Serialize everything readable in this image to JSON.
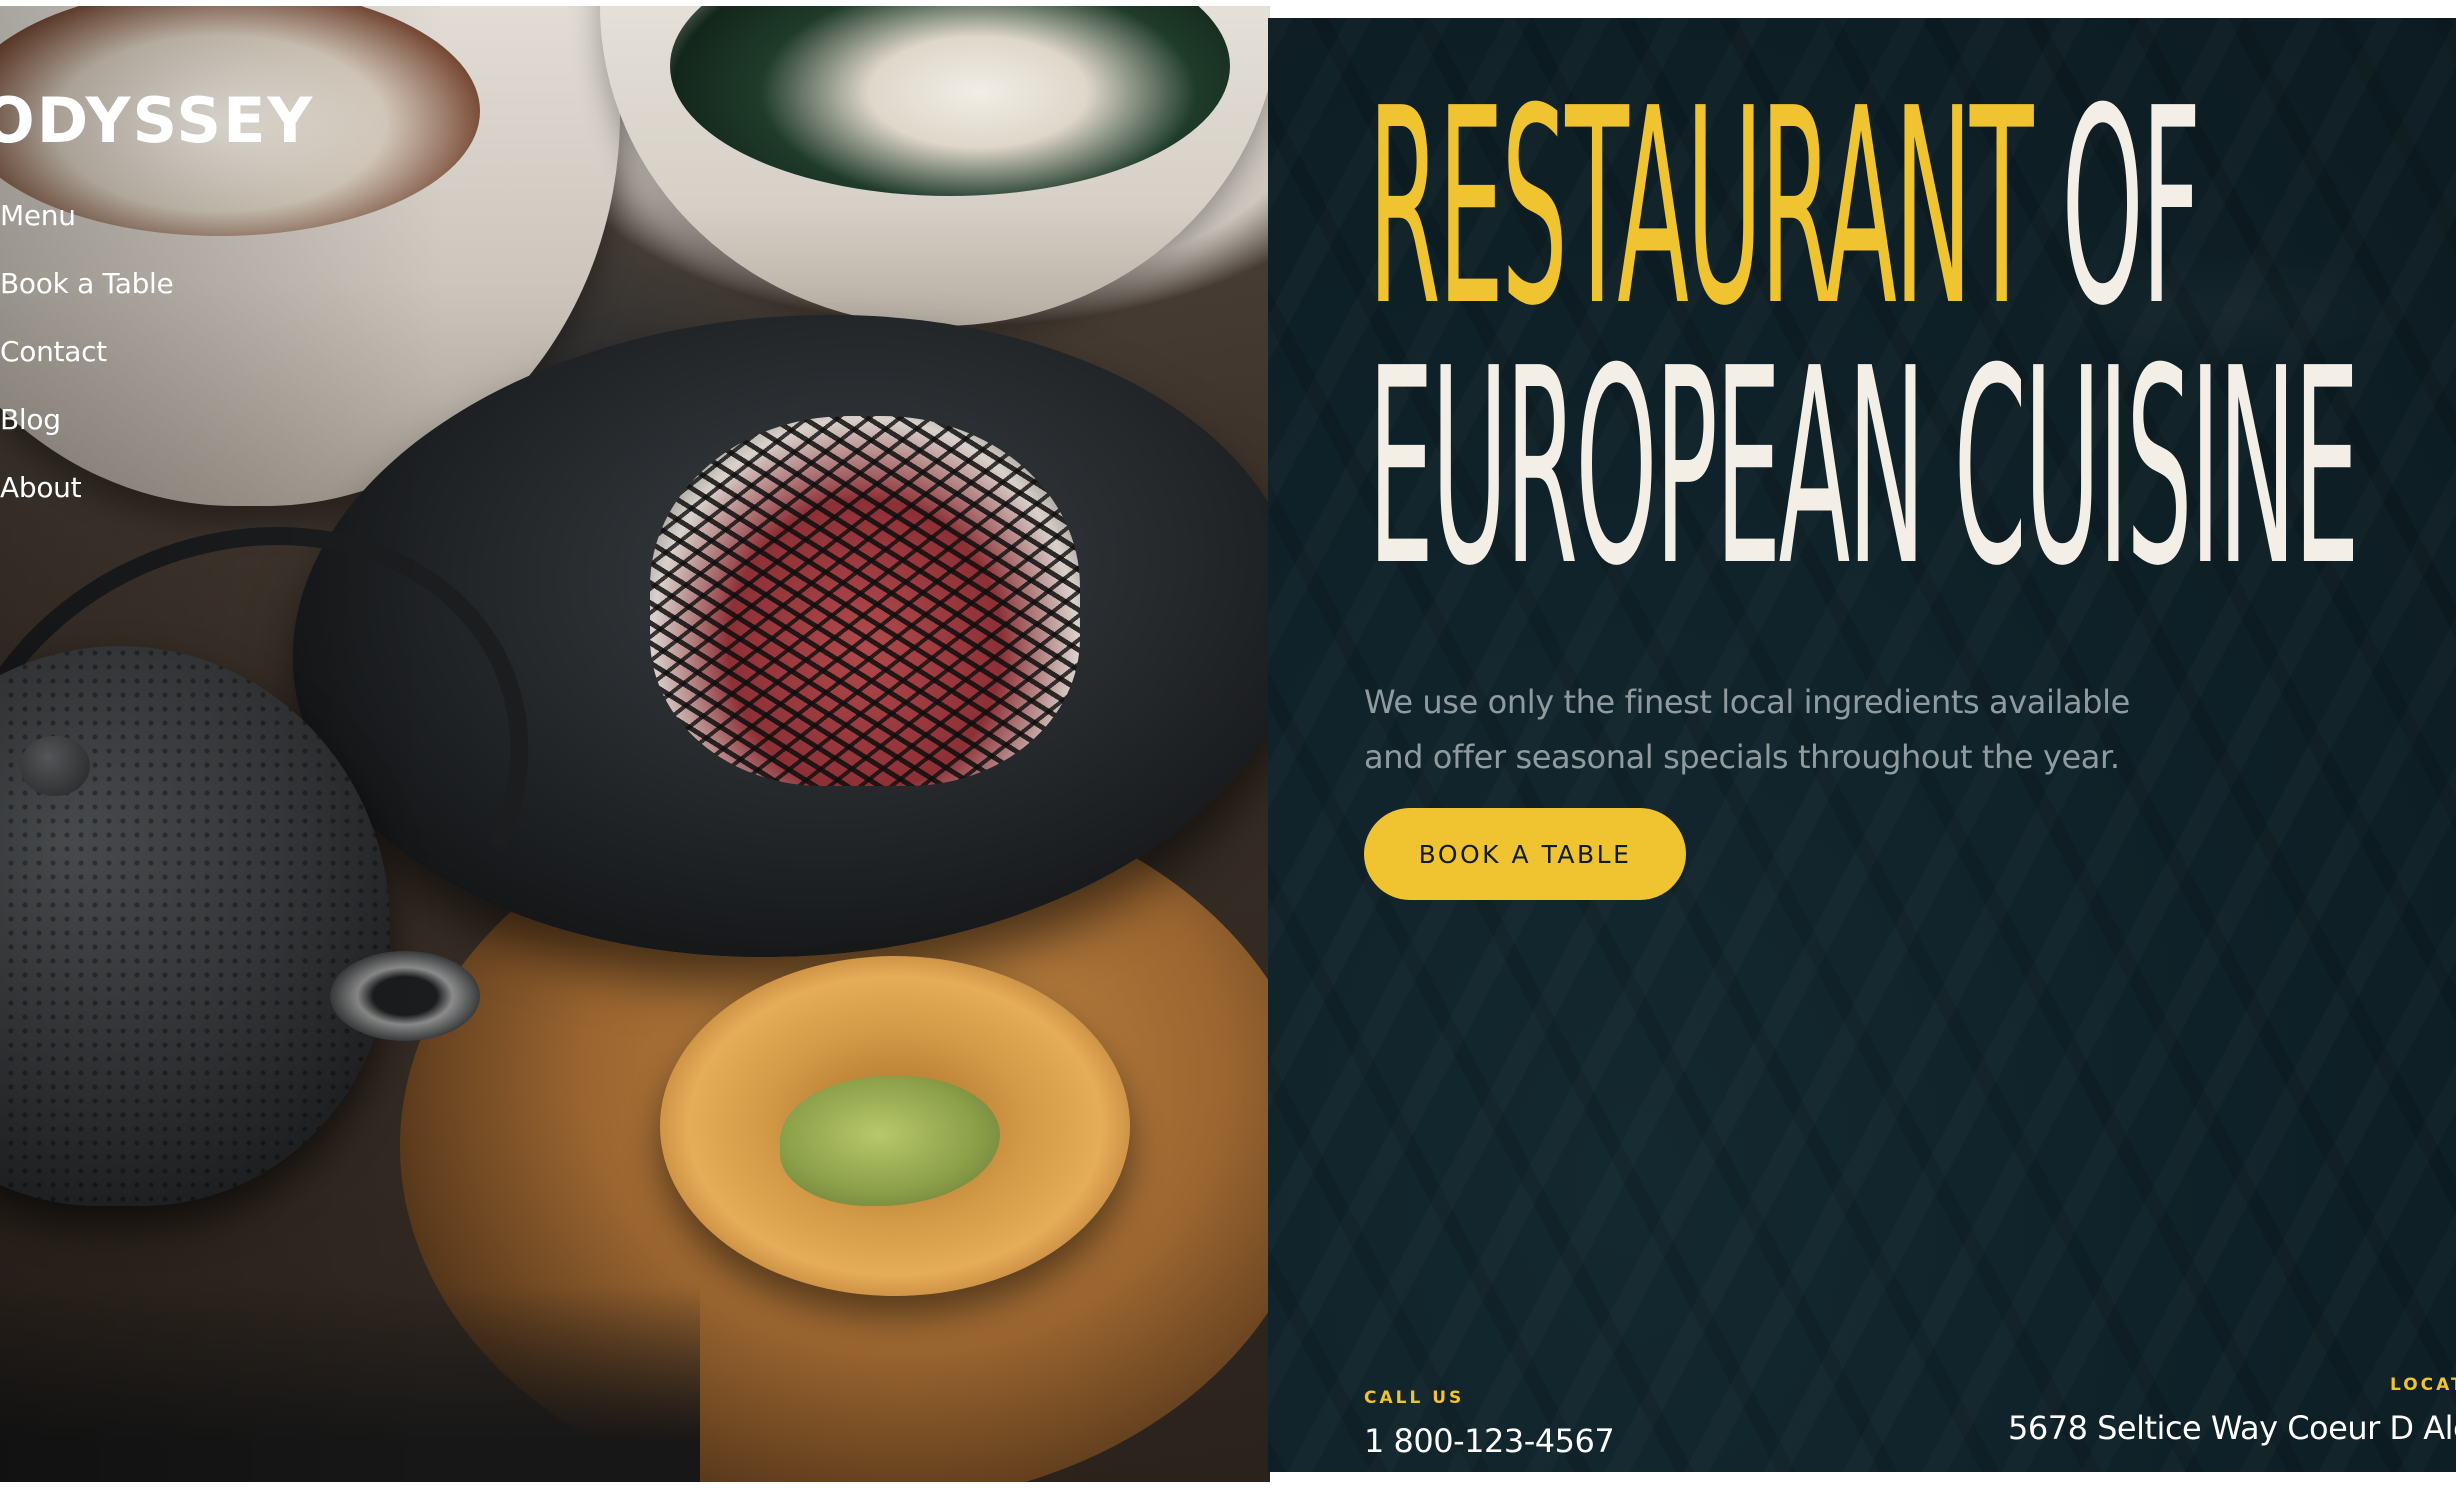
{
  "header": {
    "brand": "ODYSSEY",
    "nav": [
      {
        "label": "Menu"
      },
      {
        "label": "Book a Table"
      },
      {
        "label": "Contact"
      },
      {
        "label": "Blog"
      },
      {
        "label": "About"
      }
    ]
  },
  "hero": {
    "headline_line1_highlight": "RESTAURANT",
    "headline_line1_rest": "OF",
    "headline_line2": "EUROPEAN CUISINE",
    "subtitle": "We use only the finest local ingredients available and offer seasonal specials throughout the year.",
    "cta_label": "BOOK A TABLE"
  },
  "contact": {
    "call_label": "CALL US",
    "phone": "1 800-123-4567",
    "location_label": "LOCAT",
    "address": "5678  Seltice Way Coeur D Ale"
  },
  "colors": {
    "accent": "#f0c330",
    "panel_background": "#0f2128",
    "headline_text": "#f4efe6",
    "subtitle_text": "#8f9b9e"
  },
  "icons": []
}
